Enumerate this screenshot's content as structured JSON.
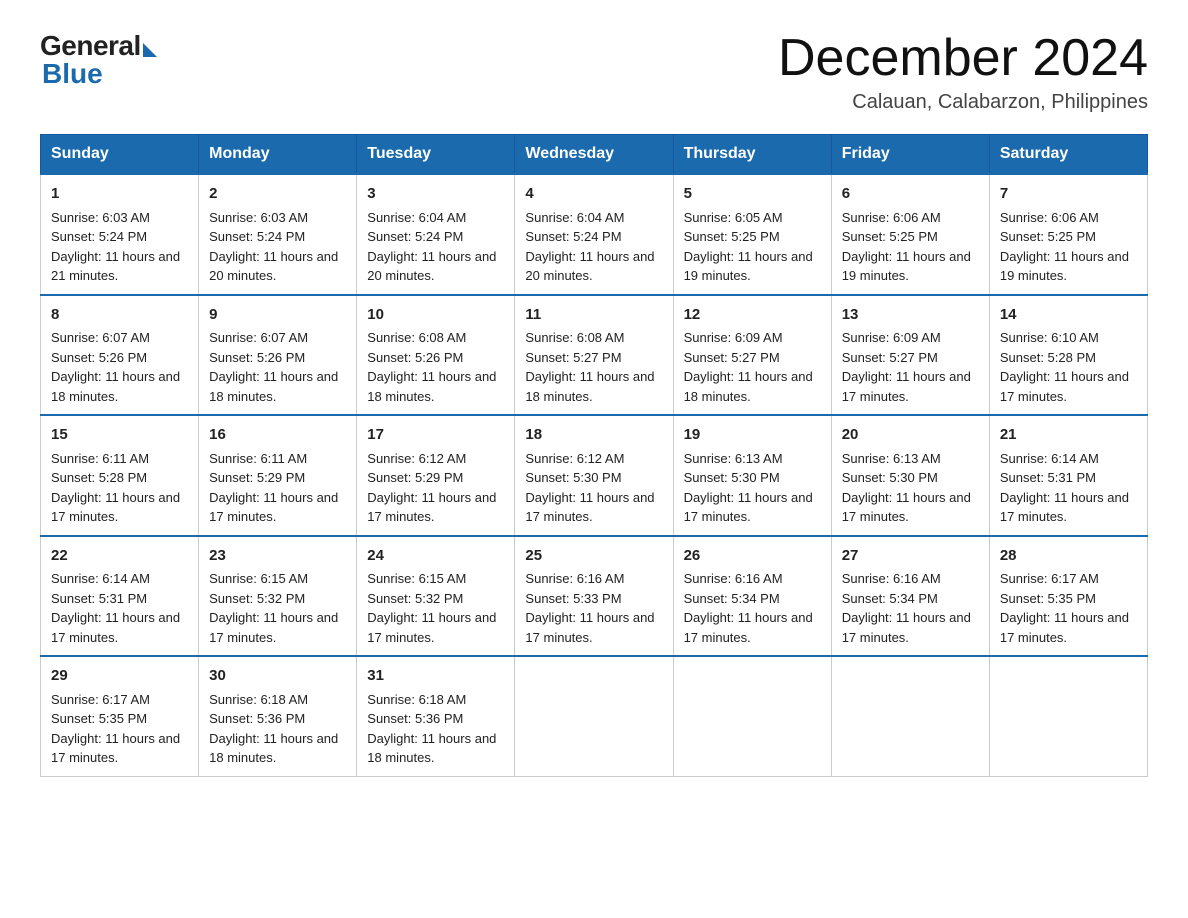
{
  "header": {
    "logo_general": "General",
    "logo_blue": "Blue",
    "month_year": "December 2024",
    "location": "Calauan, Calabarzon, Philippines"
  },
  "days_of_week": [
    "Sunday",
    "Monday",
    "Tuesday",
    "Wednesday",
    "Thursday",
    "Friday",
    "Saturday"
  ],
  "weeks": [
    [
      {
        "day": "1",
        "sunrise": "6:03 AM",
        "sunset": "5:24 PM",
        "daylight": "11 hours and 21 minutes."
      },
      {
        "day": "2",
        "sunrise": "6:03 AM",
        "sunset": "5:24 PM",
        "daylight": "11 hours and 20 minutes."
      },
      {
        "day": "3",
        "sunrise": "6:04 AM",
        "sunset": "5:24 PM",
        "daylight": "11 hours and 20 minutes."
      },
      {
        "day": "4",
        "sunrise": "6:04 AM",
        "sunset": "5:24 PM",
        "daylight": "11 hours and 20 minutes."
      },
      {
        "day": "5",
        "sunrise": "6:05 AM",
        "sunset": "5:25 PM",
        "daylight": "11 hours and 19 minutes."
      },
      {
        "day": "6",
        "sunrise": "6:06 AM",
        "sunset": "5:25 PM",
        "daylight": "11 hours and 19 minutes."
      },
      {
        "day": "7",
        "sunrise": "6:06 AM",
        "sunset": "5:25 PM",
        "daylight": "11 hours and 19 minutes."
      }
    ],
    [
      {
        "day": "8",
        "sunrise": "6:07 AM",
        "sunset": "5:26 PM",
        "daylight": "11 hours and 18 minutes."
      },
      {
        "day": "9",
        "sunrise": "6:07 AM",
        "sunset": "5:26 PM",
        "daylight": "11 hours and 18 minutes."
      },
      {
        "day": "10",
        "sunrise": "6:08 AM",
        "sunset": "5:26 PM",
        "daylight": "11 hours and 18 minutes."
      },
      {
        "day": "11",
        "sunrise": "6:08 AM",
        "sunset": "5:27 PM",
        "daylight": "11 hours and 18 minutes."
      },
      {
        "day": "12",
        "sunrise": "6:09 AM",
        "sunset": "5:27 PM",
        "daylight": "11 hours and 18 minutes."
      },
      {
        "day": "13",
        "sunrise": "6:09 AM",
        "sunset": "5:27 PM",
        "daylight": "11 hours and 17 minutes."
      },
      {
        "day": "14",
        "sunrise": "6:10 AM",
        "sunset": "5:28 PM",
        "daylight": "11 hours and 17 minutes."
      }
    ],
    [
      {
        "day": "15",
        "sunrise": "6:11 AM",
        "sunset": "5:28 PM",
        "daylight": "11 hours and 17 minutes."
      },
      {
        "day": "16",
        "sunrise": "6:11 AM",
        "sunset": "5:29 PM",
        "daylight": "11 hours and 17 minutes."
      },
      {
        "day": "17",
        "sunrise": "6:12 AM",
        "sunset": "5:29 PM",
        "daylight": "11 hours and 17 minutes."
      },
      {
        "day": "18",
        "sunrise": "6:12 AM",
        "sunset": "5:30 PM",
        "daylight": "11 hours and 17 minutes."
      },
      {
        "day": "19",
        "sunrise": "6:13 AM",
        "sunset": "5:30 PM",
        "daylight": "11 hours and 17 minutes."
      },
      {
        "day": "20",
        "sunrise": "6:13 AM",
        "sunset": "5:30 PM",
        "daylight": "11 hours and 17 minutes."
      },
      {
        "day": "21",
        "sunrise": "6:14 AM",
        "sunset": "5:31 PM",
        "daylight": "11 hours and 17 minutes."
      }
    ],
    [
      {
        "day": "22",
        "sunrise": "6:14 AM",
        "sunset": "5:31 PM",
        "daylight": "11 hours and 17 minutes."
      },
      {
        "day": "23",
        "sunrise": "6:15 AM",
        "sunset": "5:32 PM",
        "daylight": "11 hours and 17 minutes."
      },
      {
        "day": "24",
        "sunrise": "6:15 AM",
        "sunset": "5:32 PM",
        "daylight": "11 hours and 17 minutes."
      },
      {
        "day": "25",
        "sunrise": "6:16 AM",
        "sunset": "5:33 PM",
        "daylight": "11 hours and 17 minutes."
      },
      {
        "day": "26",
        "sunrise": "6:16 AM",
        "sunset": "5:34 PM",
        "daylight": "11 hours and 17 minutes."
      },
      {
        "day": "27",
        "sunrise": "6:16 AM",
        "sunset": "5:34 PM",
        "daylight": "11 hours and 17 minutes."
      },
      {
        "day": "28",
        "sunrise": "6:17 AM",
        "sunset": "5:35 PM",
        "daylight": "11 hours and 17 minutes."
      }
    ],
    [
      {
        "day": "29",
        "sunrise": "6:17 AM",
        "sunset": "5:35 PM",
        "daylight": "11 hours and 17 minutes."
      },
      {
        "day": "30",
        "sunrise": "6:18 AM",
        "sunset": "5:36 PM",
        "daylight": "11 hours and 18 minutes."
      },
      {
        "day": "31",
        "sunrise": "6:18 AM",
        "sunset": "5:36 PM",
        "daylight": "11 hours and 18 minutes."
      },
      null,
      null,
      null,
      null
    ]
  ]
}
